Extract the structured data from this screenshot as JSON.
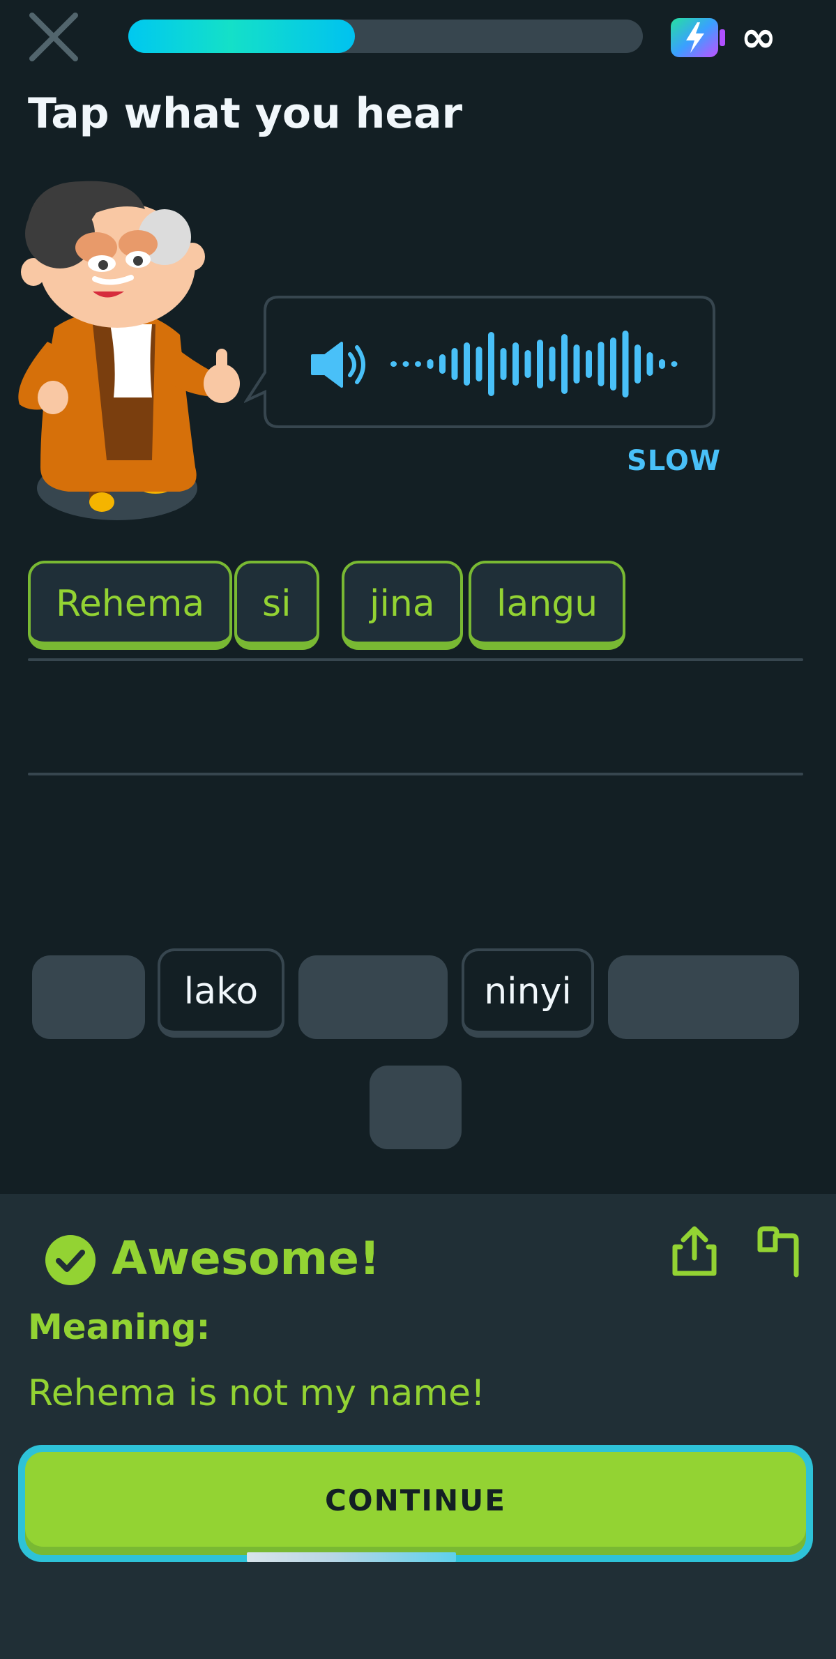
{
  "header": {
    "progress_fraction": 0.44,
    "infinity_label": "∞"
  },
  "prompt": {
    "title": "Tap what you hear",
    "slow_label": "SLOW"
  },
  "answer": {
    "words": [
      "Rehema",
      "si",
      "jina",
      "langu"
    ]
  },
  "word_bank": {
    "row1": [
      {
        "text": "",
        "used": true
      },
      {
        "text": "lako",
        "used": false
      },
      {
        "text": "",
        "used": true
      },
      {
        "text": "ninyi",
        "used": false
      },
      {
        "text": "",
        "used": true
      }
    ],
    "row2": [
      {
        "text": "",
        "used": true
      }
    ]
  },
  "feedback": {
    "heading": "Awesome!",
    "meaning_label": "Meaning:",
    "meaning_text": "Rehema is not my name!",
    "continue_label": "CONTINUE"
  },
  "colors": {
    "background": "#131f24",
    "accent_green": "#93d333",
    "accent_blue": "#49c0f8"
  }
}
